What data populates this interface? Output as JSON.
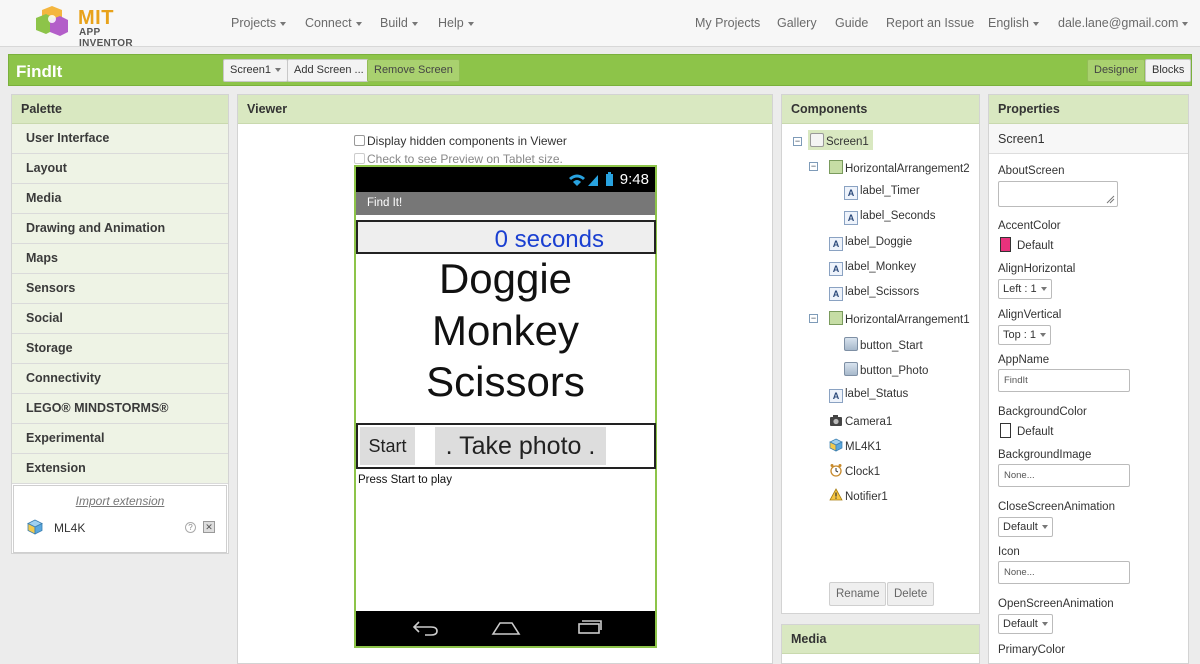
{
  "brand": {
    "mit": "MIT",
    "app_inventor": "APP INVENTOR"
  },
  "nav": {
    "left": [
      "Projects",
      "Connect",
      "Build",
      "Help"
    ],
    "right": [
      "My Projects",
      "Gallery",
      "Guide",
      "Report an Issue"
    ],
    "language": "English",
    "user": "dale.lane@gmail.com"
  },
  "project": {
    "name": "FindIt",
    "screen_select": "Screen1",
    "add_screen": "Add Screen ...",
    "remove_screen": "Remove Screen",
    "designer": "Designer",
    "blocks": "Blocks"
  },
  "palette": {
    "title": "Palette",
    "categories": [
      "User Interface",
      "Layout",
      "Media",
      "Drawing and Animation",
      "Maps",
      "Sensors",
      "Social",
      "Storage",
      "Connectivity",
      "LEGO® MINDSTORMS®",
      "Experimental",
      "Extension"
    ],
    "import_extension": "Import extension",
    "extension_item": "ML4K",
    "help_glyph": "?",
    "delete_glyph": "✕"
  },
  "viewer": {
    "title": "Viewer",
    "show_hidden": "Display hidden components in Viewer",
    "tablet_preview": "Check to see Preview on Tablet size.",
    "phone": {
      "time": "9:48",
      "app_title": "Find It!",
      "timer_text": "0  seconds",
      "words": [
        "Doggie",
        "Monkey",
        "Scissors"
      ],
      "start_button": "Start",
      "photo_button": ". Take photo .",
      "status_text": "Press Start to play"
    }
  },
  "components": {
    "title": "Components",
    "tree": [
      {
        "name": "Screen1",
        "type": "screen",
        "toggle": "−"
      },
      {
        "name": "HorizontalArrangement2",
        "type": "harr",
        "toggle": "−"
      },
      {
        "name": "label_Timer",
        "type": "label"
      },
      {
        "name": "label_Seconds",
        "type": "label"
      },
      {
        "name": "label_Doggie",
        "type": "label"
      },
      {
        "name": "label_Monkey",
        "type": "label"
      },
      {
        "name": "label_Scissors",
        "type": "label"
      },
      {
        "name": "HorizontalArrangement1",
        "type": "harr",
        "toggle": "−"
      },
      {
        "name": "button_Start",
        "type": "button"
      },
      {
        "name": "button_Photo",
        "type": "button"
      },
      {
        "name": "label_Status",
        "type": "label"
      },
      {
        "name": "Camera1",
        "type": "camera"
      },
      {
        "name": "ML4K1",
        "type": "ml4k"
      },
      {
        "name": "Clock1",
        "type": "clock"
      },
      {
        "name": "Notifier1",
        "type": "notifier"
      }
    ],
    "label_icon_glyph": "A",
    "rename": "Rename",
    "delete": "Delete",
    "media_title": "Media"
  },
  "properties": {
    "title": "Properties",
    "component": "Screen1",
    "about_screen_label": "AboutScreen",
    "accent_color_label": "AccentColor",
    "accent_color_value": "Default",
    "accent_color": "#e8327c",
    "align_horizontal_label": "AlignHorizontal",
    "align_horizontal_value": "Left : 1",
    "align_vertical_label": "AlignVertical",
    "align_vertical_value": "Top : 1",
    "app_name_label": "AppName",
    "app_name_value": "FindIt",
    "background_color_label": "BackgroundColor",
    "background_color_value": "Default",
    "background_color": "#ffffff",
    "background_image_label": "BackgroundImage",
    "background_image_value": "None...",
    "close_anim_label": "CloseScreenAnimation",
    "close_anim_value": "Default",
    "icon_label": "Icon",
    "icon_value": "None...",
    "open_anim_label": "OpenScreenAnimation",
    "open_anim_value": "Default",
    "primary_color_label": "PrimaryColor"
  },
  "colors": {
    "accent_green": "#8dc449",
    "panel_header": "#d9e8c1",
    "timer_blue": "#1a3fd1"
  }
}
